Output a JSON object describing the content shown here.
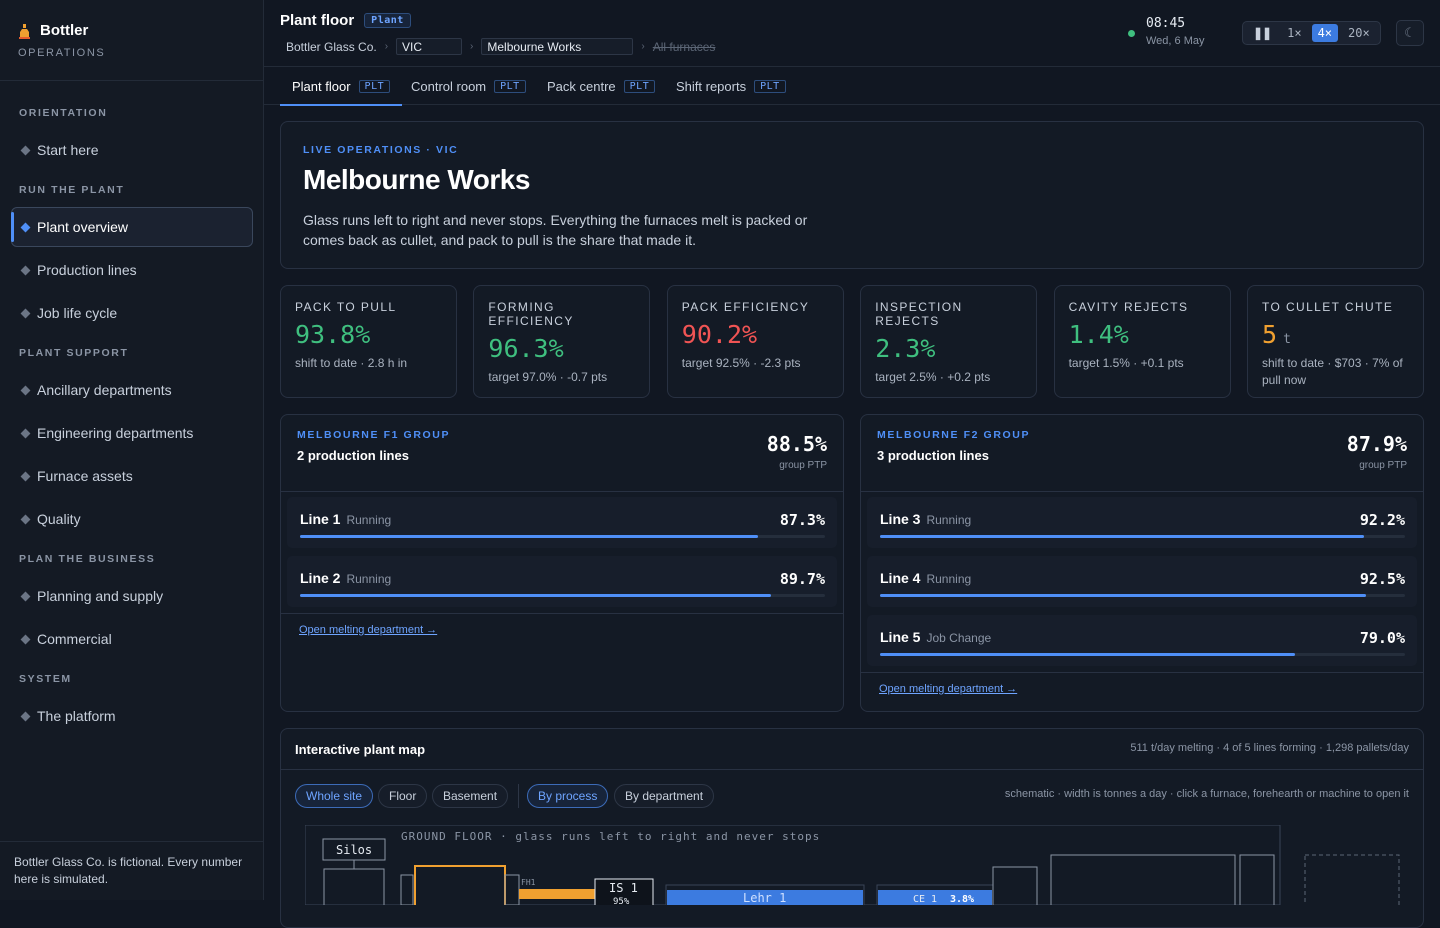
{
  "brand": {
    "name": "Bottler",
    "subtitle": "OPERATIONS"
  },
  "nav": {
    "sections": [
      {
        "title": "ORIENTATION",
        "items": [
          {
            "label": "Start here"
          }
        ]
      },
      {
        "title": "RUN THE PLANT",
        "items": [
          {
            "label": "Plant overview",
            "active": true
          },
          {
            "label": "Production lines"
          },
          {
            "label": "Job life cycle"
          }
        ]
      },
      {
        "title": "PLANT SUPPORT",
        "items": [
          {
            "label": "Ancillary departments"
          },
          {
            "label": "Engineering departments"
          },
          {
            "label": "Furnace assets"
          },
          {
            "label": "Quality"
          }
        ]
      },
      {
        "title": "PLAN THE BUSINESS",
        "items": [
          {
            "label": "Planning and supply"
          },
          {
            "label": "Commercial"
          }
        ]
      },
      {
        "title": "SYSTEM",
        "items": [
          {
            "label": "The platform"
          }
        ]
      }
    ],
    "footer": "Bottler Glass Co. is fictional. Every number here is simulated."
  },
  "topbar": {
    "title": "Plant floor",
    "badge": "Plant",
    "crumbs": {
      "company": "Bottler Glass Co.",
      "region": "VIC",
      "site": "Melbourne Works",
      "furnaces": "All furnaces"
    },
    "time": "08:45",
    "date": "Wed, 6 May",
    "speeds": [
      "1×",
      "4×",
      "20×"
    ],
    "active_speed": "4×",
    "theme_glyph": "☾"
  },
  "tabs": [
    {
      "label": "Plant floor",
      "badge": "PLT",
      "active": true
    },
    {
      "label": "Control room",
      "badge": "PLT"
    },
    {
      "label": "Pack centre",
      "badge": "PLT"
    },
    {
      "label": "Shift reports",
      "badge": "PLT"
    }
  ],
  "hero": {
    "eyebrow": "LIVE OPERATIONS · VIC",
    "title": "Melbourne Works",
    "body": "Glass runs left to right and never stops. Everything the furnaces melt is packed or comes back as cullet, and pack to pull is the share that made it."
  },
  "kpis": [
    {
      "label": "PACK TO PULL",
      "value": "93.8%",
      "unit": "",
      "note": "shift to date · 2.8 h in",
      "color": "#3fbf7f"
    },
    {
      "label": "FORMING EFFICIENCY",
      "value": "96.3%",
      "unit": "",
      "note": "target 97.0% · -0.7 pts",
      "color": "#3fbf7f"
    },
    {
      "label": "PACK EFFICIENCY",
      "value": "90.2%",
      "unit": "",
      "note": "target 92.5% · -2.3 pts",
      "color": "#f05454"
    },
    {
      "label": "INSPECTION REJECTS",
      "value": "2.3%",
      "unit": "",
      "note": "target 2.5% · +0.2 pts",
      "color": "#3fbf7f"
    },
    {
      "label": "CAVITY REJECTS",
      "value": "1.4%",
      "unit": "",
      "note": "target 1.5% · +0.1 pts",
      "color": "#3fbf7f"
    },
    {
      "label": "TO CULLET CHUTE",
      "value": "5",
      "unit": "t",
      "note": "shift to date · $703 · 7% of pull now",
      "color": "#f0a030"
    }
  ],
  "groups": [
    {
      "eyebrow": "MELBOURNE F1 GROUP",
      "subtitle": "2 production lines",
      "value": "88.5%",
      "value_label": "group PTP",
      "link": "Open melting department →",
      "lines": [
        {
          "name": "Line 1",
          "status": "Running",
          "value": "87.3%",
          "progress": 0.873
        },
        {
          "name": "Line 2",
          "status": "Running",
          "value": "89.7%",
          "progress": 0.897
        }
      ]
    },
    {
      "eyebrow": "MELBOURNE F2 GROUP",
      "subtitle": "3 production lines",
      "value": "87.9%",
      "value_label": "group PTP",
      "link": "Open melting department →",
      "lines": [
        {
          "name": "Line 3",
          "status": "Running",
          "value": "92.2%",
          "progress": 0.922
        },
        {
          "name": "Line 4",
          "status": "Running",
          "value": "92.5%",
          "progress": 0.925
        },
        {
          "name": "Line 5",
          "status": "Job Change",
          "value": "79.0%",
          "progress": 0.79
        }
      ]
    }
  ],
  "map": {
    "title": "Interactive plant map",
    "stats": "511 t/day melting · 4 of 5 lines forming · 1,298 pallets/day",
    "filters": [
      "Whole site",
      "Floor",
      "Basement"
    ],
    "active_filter": "Whole site",
    "views": [
      "By process",
      "By department"
    ],
    "active_view": "By process",
    "hint": "schematic · width is tonnes a day · click a furnace, forehearth or machine to open it",
    "floor_label": "GROUND FLOOR · glass runs left to right and never stops",
    "silos": "Silos",
    "fh": "FH1",
    "is": "IS 1",
    "is_val": "95%",
    "lehr": "Lehr 1",
    "ce": "CE 1",
    "ce_val": "3.8%"
  }
}
